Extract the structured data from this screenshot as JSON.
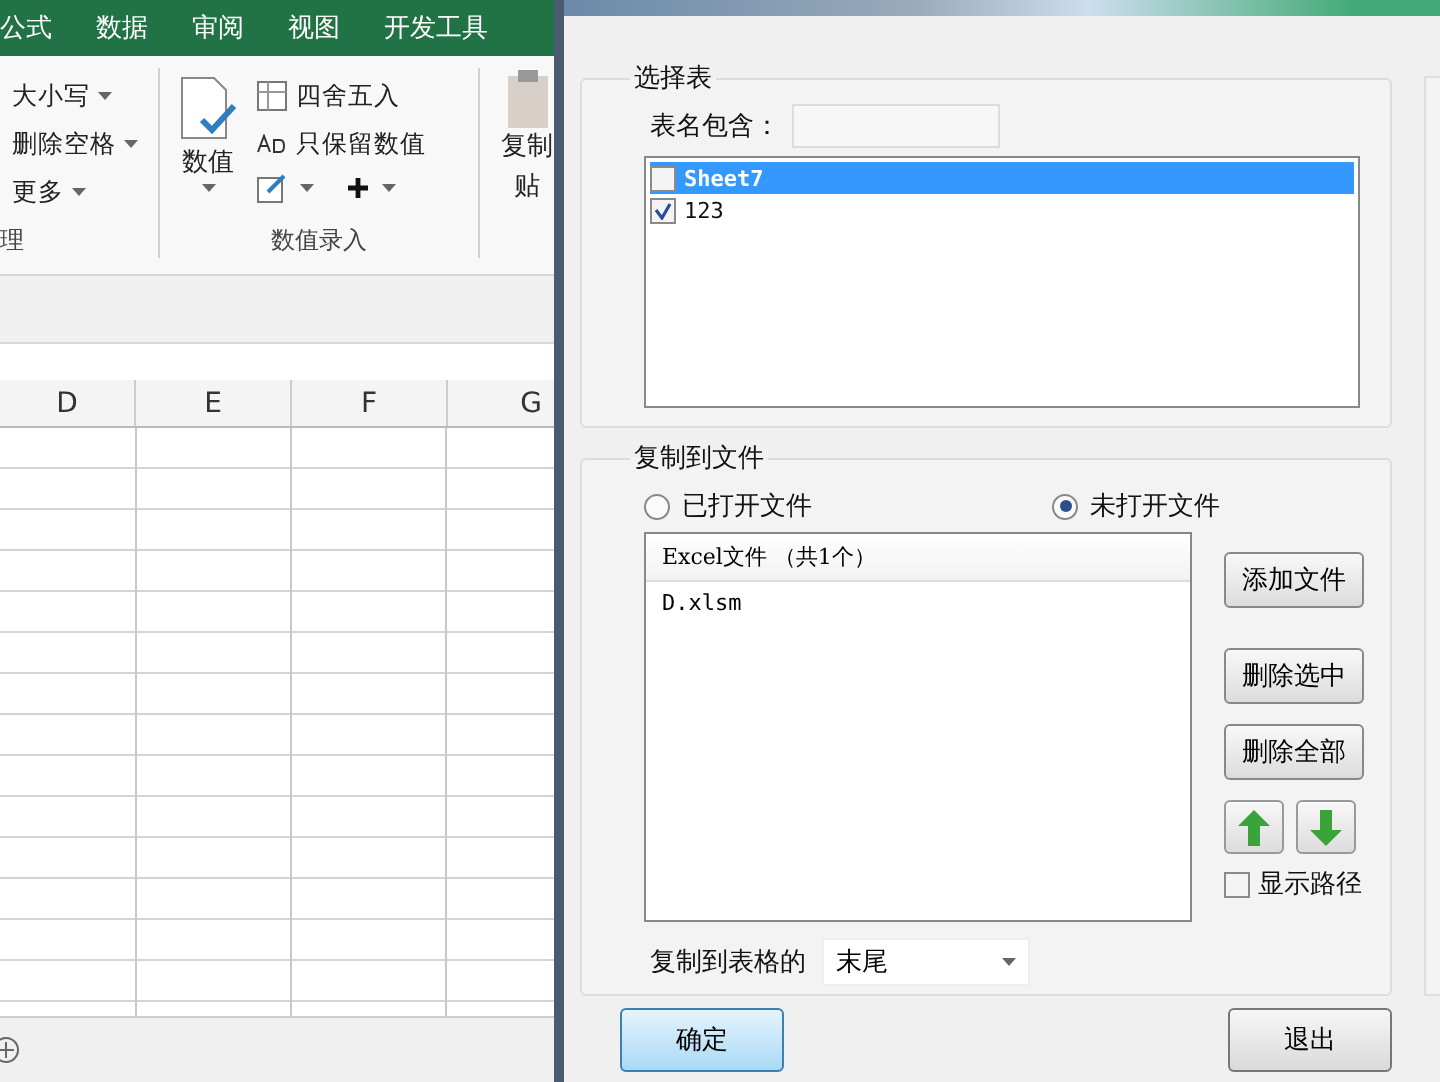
{
  "ribbon": {
    "tabs": [
      "公式",
      "数据",
      "审阅",
      "视图",
      "开发工具"
    ],
    "text_group": {
      "items": [
        "大小写",
        "删除空格",
        "更多"
      ],
      "label": "理"
    },
    "number_group": {
      "big_button": "数值",
      "items": [
        {
          "kind": "round",
          "label": "四舍五入"
        },
        {
          "kind": "keep",
          "label": "只保留数值"
        }
      ],
      "label": "数值录入"
    },
    "paste_group": {
      "lines": [
        "复制",
        "贴"
      ]
    }
  },
  "sheet": {
    "columns": [
      "D",
      "E",
      "F",
      "G"
    ]
  },
  "dialog": {
    "select_sheets": {
      "title": "选择表",
      "filter_label": "表名包含：",
      "sheets": [
        {
          "name": "Sheet7",
          "checked": false,
          "selected": true
        },
        {
          "name": "123",
          "checked": true,
          "selected": false
        }
      ]
    },
    "copy_to_file": {
      "title": "复制到文件",
      "radios": [
        {
          "label": "已打开文件",
          "selected": false
        },
        {
          "label": "未打开文件",
          "selected": true
        }
      ],
      "list_header": "Excel文件 （共1个）",
      "files": [
        "D.xlsm"
      ],
      "buttons": [
        "添加文件",
        "删除选中",
        "删除全部"
      ],
      "show_path": {
        "label": "显示路径",
        "checked": false
      },
      "position_label": "复制到表格的",
      "position": "末尾"
    },
    "ok": "确定",
    "exit": "退出"
  }
}
